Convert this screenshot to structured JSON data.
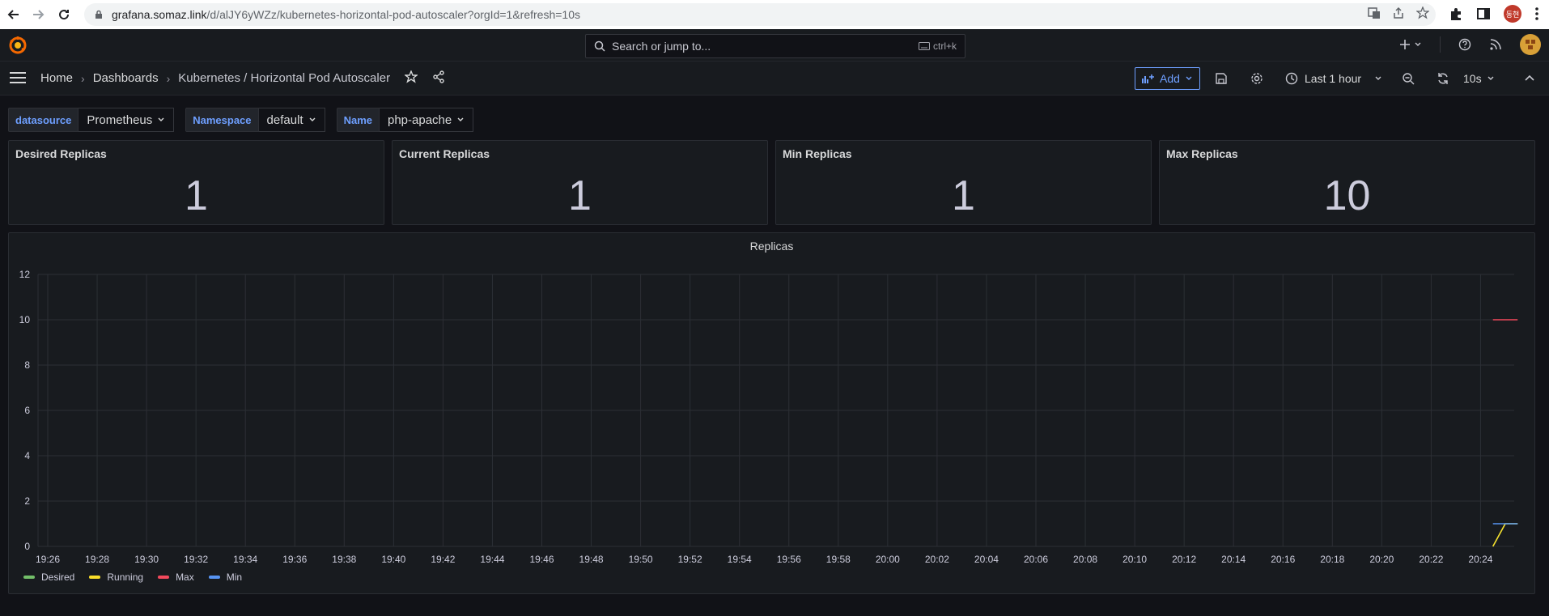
{
  "browser": {
    "url_host": "grafana.somaz.link",
    "url_path": "/d/alJY6yWZz/kubernetes-horizontal-pod-autoscaler?orgId=1&refresh=10s",
    "profile_initials": "동현"
  },
  "topbar": {
    "search_placeholder": "Search or jump to...",
    "search_shortcut": "ctrl+k"
  },
  "breadcrumb": {
    "home": "Home",
    "dashboards": "Dashboards",
    "current": "Kubernetes / Horizontal Pod Autoscaler"
  },
  "toolbar": {
    "add_label": "Add",
    "time_range": "Last 1 hour",
    "refresh_interval": "10s"
  },
  "variables": [
    {
      "label": "datasource",
      "value": "Prometheus"
    },
    {
      "label": "Namespace",
      "value": "default"
    },
    {
      "label": "Name",
      "value": "php-apache"
    }
  ],
  "stats": [
    {
      "title": "Desired Replicas",
      "value": "1"
    },
    {
      "title": "Current Replicas",
      "value": "1"
    },
    {
      "title": "Min Replicas",
      "value": "1"
    },
    {
      "title": "Max Replicas",
      "value": "10"
    }
  ],
  "chart_data": {
    "type": "line",
    "title": "Replicas",
    "x_ticks": [
      "19:26",
      "19:28",
      "19:30",
      "19:32",
      "19:34",
      "19:36",
      "19:38",
      "19:40",
      "19:42",
      "19:44",
      "19:46",
      "19:48",
      "19:50",
      "19:52",
      "19:54",
      "19:56",
      "19:58",
      "20:00",
      "20:02",
      "20:04",
      "20:06",
      "20:08",
      "20:10",
      "20:12",
      "20:14",
      "20:16",
      "20:18",
      "20:20",
      "20:22",
      "20:24"
    ],
    "y_ticks": [
      0,
      2,
      4,
      6,
      8,
      10,
      12
    ],
    "ylim": [
      0,
      12
    ],
    "grid": true,
    "legend_position": "bottom-left",
    "series": [
      {
        "name": "Desired",
        "color": "#73bf69",
        "x": [
          "20:24.5",
          "20:25",
          "20:25.5"
        ],
        "values": [
          0,
          1,
          1
        ]
      },
      {
        "name": "Running",
        "color": "#fade2a",
        "x": [
          "20:24.5",
          "20:25",
          "20:25.5"
        ],
        "values": [
          0,
          1,
          1
        ]
      },
      {
        "name": "Max",
        "color": "#f2495c",
        "x": [
          "20:24.5",
          "20:25.5"
        ],
        "values": [
          10,
          10
        ]
      },
      {
        "name": "Min",
        "color": "#5794f2",
        "x": [
          "20:24.5",
          "20:25.5"
        ],
        "values": [
          1,
          1
        ]
      }
    ]
  }
}
